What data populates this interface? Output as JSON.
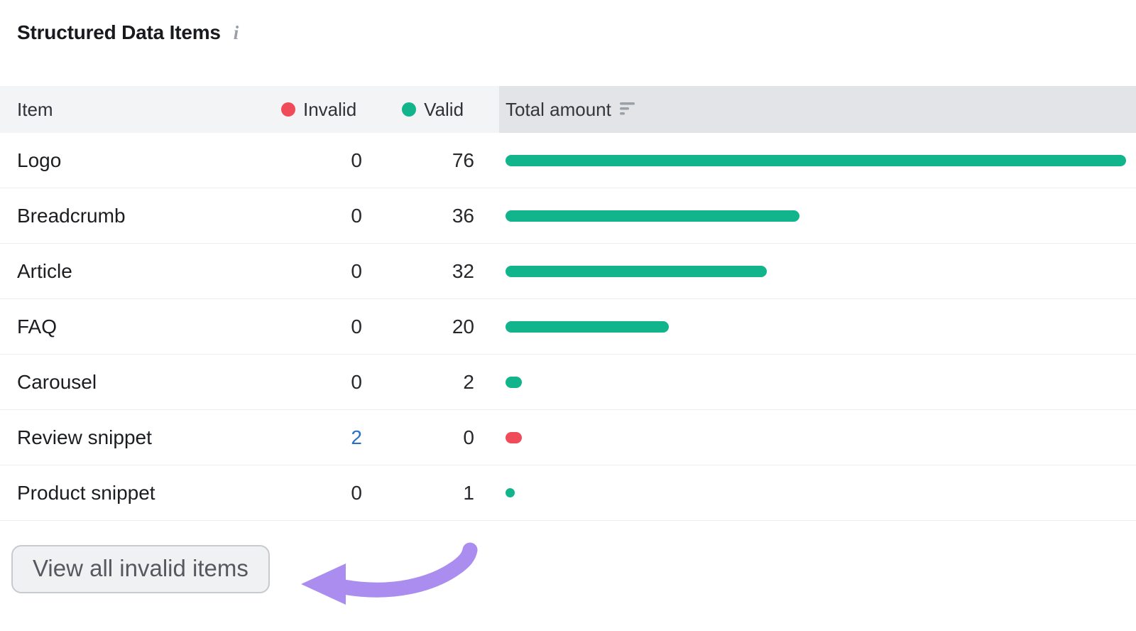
{
  "page": {
    "title": "Structured Data Items",
    "info_icon": "i"
  },
  "table": {
    "columns": {
      "item": "Item",
      "invalid": "Invalid",
      "valid": "Valid",
      "total": "Total amount"
    },
    "rows": [
      {
        "item": "Logo",
        "invalid": 0,
        "valid": 76
      },
      {
        "item": "Breadcrumb",
        "invalid": 0,
        "valid": 36
      },
      {
        "item": "Article",
        "invalid": 0,
        "valid": 32
      },
      {
        "item": "FAQ",
        "invalid": 0,
        "valid": 20
      },
      {
        "item": "Carousel",
        "invalid": 0,
        "valid": 2
      },
      {
        "item": "Review snippet",
        "invalid": 2,
        "valid": 0
      },
      {
        "item": "Product snippet",
        "invalid": 0,
        "valid": 1
      }
    ]
  },
  "footer": {
    "view_all_button": "View all invalid items"
  },
  "colors": {
    "valid_green": "#12b48c",
    "invalid_red": "#f04b58",
    "link_blue": "#2a70c4",
    "arrow_purple": "#ab8df0",
    "header_bg_light": "#f3f4f6",
    "header_bg_gray": "#e2e4e8"
  }
}
